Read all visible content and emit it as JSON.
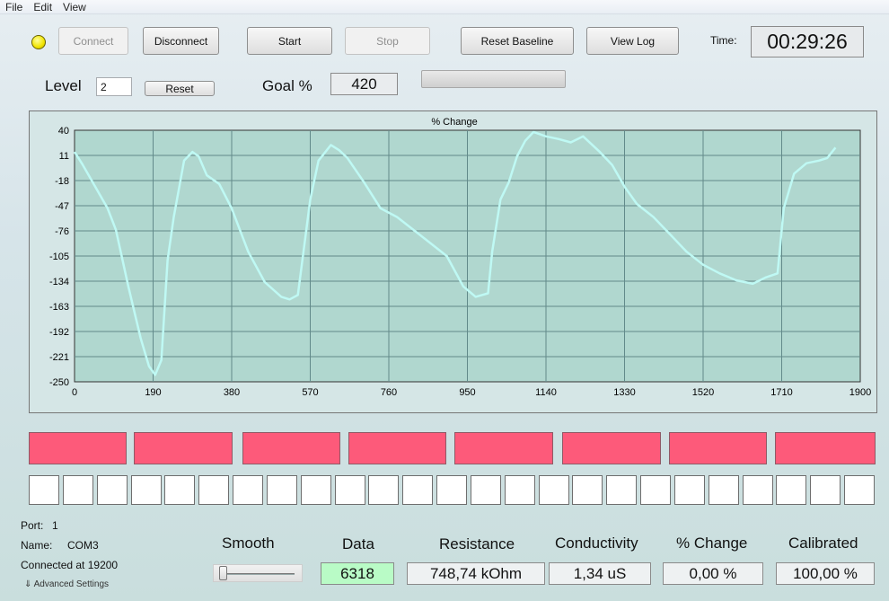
{
  "menu": [
    "File",
    "Edit",
    "View"
  ],
  "toolbar": {
    "connect": "Connect",
    "disconnect": "Disconnect",
    "start": "Start",
    "stop": "Stop",
    "reset_baseline": "Reset Baseline",
    "view_log": "View Log",
    "time_label": "Time:",
    "time_value": "00:29:26"
  },
  "level": {
    "label": "Level",
    "value": "2",
    "reset": "Reset"
  },
  "goal": {
    "label": "Goal %",
    "value": "420"
  },
  "colors": {
    "trace": "#bff9f4",
    "plot_bg": "#b0d7cf",
    "red_box": "#fd5a7a",
    "grid": "#628a8a"
  },
  "chart_data": {
    "type": "line",
    "title": "% Change",
    "xlim": [
      0,
      1900
    ],
    "ylim": [
      -250,
      40
    ],
    "x_ticks": [
      "0",
      "190",
      "380",
      "570",
      "760",
      "950",
      "1140",
      "1330",
      "1520",
      "1710",
      "1900"
    ],
    "y_ticks": [
      "40",
      "11",
      "-18",
      "-47",
      "-76",
      "-105",
      "-134",
      "-163",
      "-192",
      "-221",
      "-250"
    ],
    "grid": true,
    "series": [
      {
        "points": [
          [
            0,
            15
          ],
          [
            20,
            0
          ],
          [
            50,
            -25
          ],
          [
            80,
            -50
          ],
          [
            100,
            -75
          ],
          [
            130,
            -140
          ],
          [
            160,
            -200
          ],
          [
            180,
            -232
          ],
          [
            195,
            -242
          ],
          [
            210,
            -225
          ],
          [
            225,
            -110
          ],
          [
            240,
            -60
          ],
          [
            265,
            5
          ],
          [
            285,
            15
          ],
          [
            300,
            10
          ],
          [
            320,
            -12
          ],
          [
            350,
            -22
          ],
          [
            380,
            -50
          ],
          [
            420,
            -100
          ],
          [
            460,
            -135
          ],
          [
            500,
            -152
          ],
          [
            520,
            -155
          ],
          [
            540,
            -150
          ],
          [
            555,
            -95
          ],
          [
            570,
            -40
          ],
          [
            590,
            5
          ],
          [
            620,
            23
          ],
          [
            640,
            17
          ],
          [
            660,
            8
          ],
          [
            700,
            -20
          ],
          [
            740,
            -50
          ],
          [
            780,
            -60
          ],
          [
            820,
            -75
          ],
          [
            860,
            -90
          ],
          [
            900,
            -105
          ],
          [
            940,
            -140
          ],
          [
            970,
            -152
          ],
          [
            1000,
            -148
          ],
          [
            1010,
            -100
          ],
          [
            1030,
            -40
          ],
          [
            1050,
            -20
          ],
          [
            1070,
            10
          ],
          [
            1090,
            28
          ],
          [
            1110,
            38
          ],
          [
            1140,
            33
          ],
          [
            1170,
            30
          ],
          [
            1200,
            26
          ],
          [
            1230,
            33
          ],
          [
            1270,
            15
          ],
          [
            1300,
            0
          ],
          [
            1330,
            -25
          ],
          [
            1360,
            -45
          ],
          [
            1400,
            -60
          ],
          [
            1440,
            -80
          ],
          [
            1480,
            -100
          ],
          [
            1520,
            -115
          ],
          [
            1560,
            -125
          ],
          [
            1600,
            -133
          ],
          [
            1640,
            -137
          ],
          [
            1670,
            -130
          ],
          [
            1700,
            -125
          ],
          [
            1715,
            -50
          ],
          [
            1740,
            -10
          ],
          [
            1770,
            2
          ],
          [
            1800,
            5
          ],
          [
            1820,
            8
          ],
          [
            1840,
            20
          ]
        ]
      }
    ]
  },
  "status": {
    "port_label": "Port:",
    "port_value": "1",
    "name_label": "Name:",
    "name_value": "COM3",
    "connected": "Connected at 19200",
    "advanced": "Advanced Settings"
  },
  "bottom": {
    "smooth": "Smooth",
    "data_label": "Data",
    "data_value": "6318",
    "resistance_label": "Resistance",
    "resistance_value": "748,74 kOhm",
    "conductivity_label": "Conductivity",
    "conductivity_value": "1,34 uS",
    "change_label": "% Change",
    "change_value": "0,00 %",
    "calibrated_label": "Calibrated",
    "calibrated_value": "100,00 %"
  }
}
